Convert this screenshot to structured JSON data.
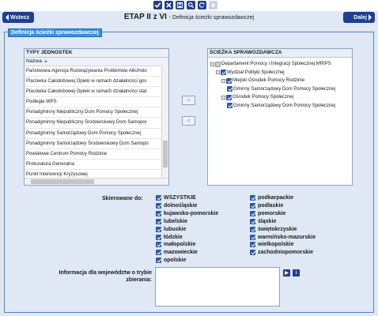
{
  "toolbar": {
    "icons": [
      "check-icon",
      "close-icon",
      "save-icon",
      "search-icon",
      "refresh-icon",
      "disabled-icon"
    ]
  },
  "nav": {
    "back_label": "Wstecz",
    "next_label": "Dalej"
  },
  "header": {
    "title": "ETAP II z VI",
    "subtitle": "- Definicja ścieżki sprawozdawczej"
  },
  "section_legend": "Definicja ścieżki sprawozdawczej",
  "left_panel": {
    "title": "TYPY JEDNOSTEK",
    "column_header": "Nazwa",
    "rows": [
      "Państwowa Agencja Rozwiązywania Problemów Alkoholo",
      "Placówka Całodobowej Opieki w ramach działalności gos",
      "Placówka Całodobowej Opieki w ramach działalności stat",
      "Podległa WPS",
      "Ponadgminny Niepubliczny Dom Pomocy Społecznej",
      "Ponadgminny Niepubliczny Środowiskowy Dom Samopor",
      "Ponadgminny Samorządowy Dom Pomocy Społecznej",
      "Ponadgminny Samorządowy Środowiskowy Dom Samopo",
      "Powiatowe Centrum Pomocy Rodzinie",
      "Prokuratura Generalna",
      "Punkt Interwencji Kryzysowej"
    ]
  },
  "move_buttons": {
    "add": ">",
    "remove": "<"
  },
  "right_panel": {
    "title": "ŚCIEŻKA SPRAWOZDAWCZA",
    "tree": [
      {
        "level": 0,
        "toggle": "-",
        "checked": "gray",
        "label": "Departament Pomocy i Integracji Społecznej MRIPS"
      },
      {
        "level": 1,
        "toggle": "-",
        "checked": "on",
        "label": "Wydział Polityki Społecznej"
      },
      {
        "level": 2,
        "toggle": "-",
        "checked": "on",
        "label": "Miejski Ośrodek Pomocy Rodzinie"
      },
      {
        "level": 3,
        "toggle": "",
        "checked": "on",
        "label": "Gminny Samorządowy Dom Pomocy Społecznej"
      },
      {
        "level": 2,
        "toggle": "-",
        "checked": "on",
        "label": "Ośrodek Pomocy Społecznej"
      },
      {
        "level": 3,
        "toggle": "",
        "checked": "on",
        "label": "Gminny Samorządowy Dom Pomocy Społecznej"
      }
    ]
  },
  "directed_to": {
    "label": "Skierowane do:",
    "left_column": [
      "WSZYSTKIE",
      "dolnośląskie",
      "kujawsko-pomorskie",
      "lubelskie",
      "lubuskie",
      "łódzkie",
      "małopolskie",
      "mazowieckie",
      "opolskie"
    ],
    "right_column": [
      "podkarpackie",
      "podlaskie",
      "pomorskie",
      "śląskie",
      "świętokrzyskie",
      "warmińsko-mazurskie",
      "wielkopolskie",
      "zachodniopomorskie"
    ]
  },
  "info": {
    "label": "Informacja dla województw o trybie zbierania:",
    "value": ""
  },
  "colors": {
    "accent": "#1f3f8f",
    "legend": "#3a8fe0",
    "background": "#dfe8f4"
  }
}
